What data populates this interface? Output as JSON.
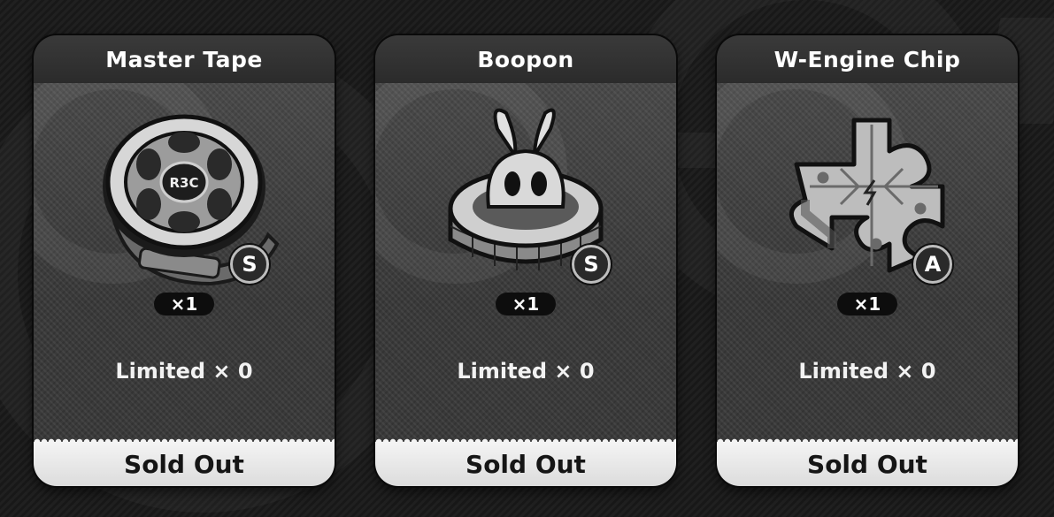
{
  "shop": {
    "items": [
      {
        "name": "Master Tape",
        "icon": "master-tape-icon",
        "rarity": "S",
        "quantity": "×1",
        "limit": "Limited × 0",
        "status": "Sold Out"
      },
      {
        "name": "Boopon",
        "icon": "boopon-icon",
        "rarity": "S",
        "quantity": "×1",
        "limit": "Limited × 0",
        "status": "Sold Out"
      },
      {
        "name": "W-Engine Chip",
        "icon": "w-engine-chip-icon",
        "rarity": "A",
        "quantity": "×1",
        "limit": "Limited × 0",
        "status": "Sold Out"
      }
    ]
  },
  "colors": {
    "card_body": "#3a3a3a",
    "header": "#2f2f2f",
    "sold_out_band": "#ececec",
    "text_light": "#ffffff",
    "text_dark": "#151515"
  }
}
